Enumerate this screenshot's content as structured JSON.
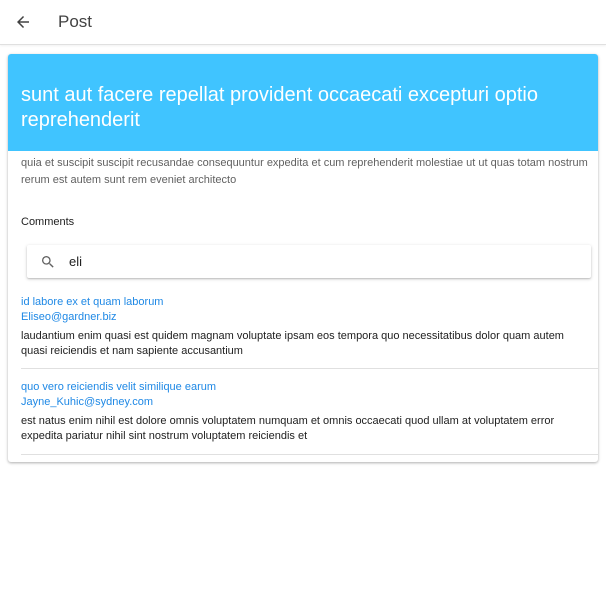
{
  "appbar": {
    "title": "Post"
  },
  "post": {
    "title": "sunt aut facere repellat provident occaecati excepturi optio reprehenderit",
    "body": "quia et suscipit suscipit recusandae consequuntur expedita et cum reprehenderit molestiae ut ut quas totam nostrum rerum est autem sunt rem eveniet architecto"
  },
  "comments": {
    "heading": "Comments",
    "search": {
      "value": "eli"
    },
    "items": [
      {
        "name": "id labore ex et quam laborum",
        "email": "Eliseo@gardner.biz",
        "body": "laudantium enim quasi est quidem magnam voluptate ipsam eos tempora quo necessitatibus dolor quam autem quasi reiciendis et nam sapiente accusantium"
      },
      {
        "name": "quo vero reiciendis velit similique earum",
        "email": "Jayne_Kuhic@sydney.com",
        "body": "est natus enim nihil est dolore omnis voluptatem numquam et omnis occaecati quod ullam at voluptatem error expedita pariatur nihil sint nostrum voluptatem reiciendis et"
      }
    ]
  },
  "icons": {
    "back": "arrow-back-icon",
    "search": "search-icon"
  },
  "colors": {
    "header": "#40c4ff",
    "link": "#1e88e5"
  }
}
